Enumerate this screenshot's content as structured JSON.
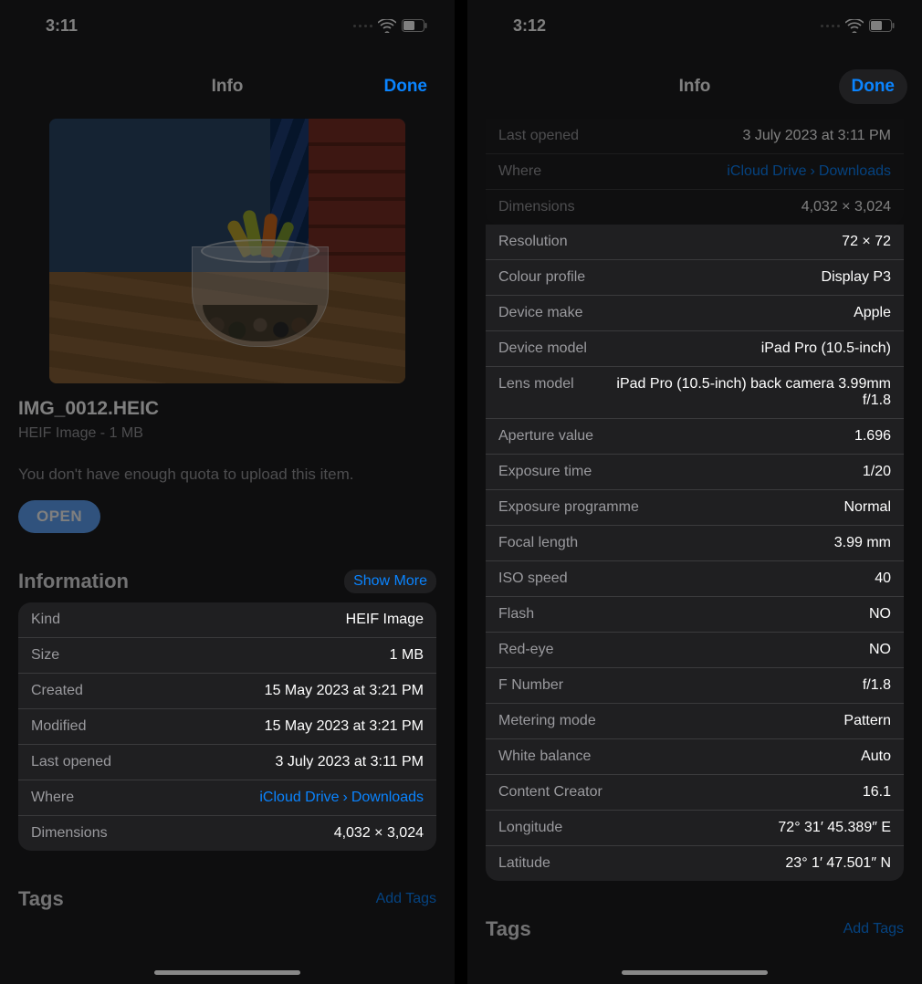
{
  "left": {
    "status_time": "3:11",
    "header_title": "Info",
    "done_label": "Done",
    "filename": "IMG_0012.HEIC",
    "filetype_line": "HEIF Image - 1 MB",
    "quota_msg": "You don't have enough quota to upload this item.",
    "open_label": "OPEN",
    "information_title": "Information",
    "show_more_label": "Show More",
    "info_rows": [
      {
        "label": "Kind",
        "value": "HEIF Image"
      },
      {
        "label": "Size",
        "value": "1 MB"
      },
      {
        "label": "Created",
        "value": "15 May 2023 at 3:21 PM"
      },
      {
        "label": "Modified",
        "value": "15 May 2023 at 3:21 PM"
      },
      {
        "label": "Last opened",
        "value": "3 July 2023 at 3:11 PM"
      },
      {
        "label": "Where",
        "value_parts": [
          "iCloud Drive",
          "Downloads"
        ],
        "link": true
      },
      {
        "label": "Dimensions",
        "value": "4,032 × 3,024"
      }
    ],
    "tags_title": "Tags",
    "add_tags_label": "Add Tags"
  },
  "right": {
    "status_time": "3:12",
    "header_title": "Info",
    "done_label": "Done",
    "dim_rows": [
      {
        "label": "Last opened",
        "value": "3 July 2023 at 3:11 PM"
      },
      {
        "label": "Where",
        "value_parts": [
          "iCloud Drive",
          "Downloads"
        ],
        "link": true
      },
      {
        "label": "Dimensions",
        "value": "4,032 × 3,024"
      }
    ],
    "info_rows": [
      {
        "label": "Resolution",
        "value": "72 × 72"
      },
      {
        "label": "Colour profile",
        "value": "Display P3"
      },
      {
        "label": "Device make",
        "value": "Apple"
      },
      {
        "label": "Device model",
        "value": "iPad Pro (10.5-inch)"
      },
      {
        "label": "Lens model",
        "value": "iPad Pro (10.5-inch) back camera 3.99mm f/1.8"
      },
      {
        "label": "Aperture value",
        "value": "1.696"
      },
      {
        "label": "Exposure time",
        "value": "1/20"
      },
      {
        "label": "Exposure programme",
        "value": "Normal"
      },
      {
        "label": "Focal length",
        "value": "3.99 mm"
      },
      {
        "label": "ISO speed",
        "value": "40"
      },
      {
        "label": "Flash",
        "value": "NO"
      },
      {
        "label": "Red-eye",
        "value": "NO"
      },
      {
        "label": "F Number",
        "value": "f/1.8"
      },
      {
        "label": "Metering mode",
        "value": "Pattern"
      },
      {
        "label": "White balance",
        "value": "Auto"
      },
      {
        "label": "Content Creator",
        "value": "16.1"
      },
      {
        "label": "Longitude",
        "value": "72° 31′ 45.389″ E"
      },
      {
        "label": "Latitude",
        "value": "23° 1′ 47.501″ N"
      }
    ],
    "tags_title": "Tags",
    "add_tags_label": "Add Tags"
  }
}
